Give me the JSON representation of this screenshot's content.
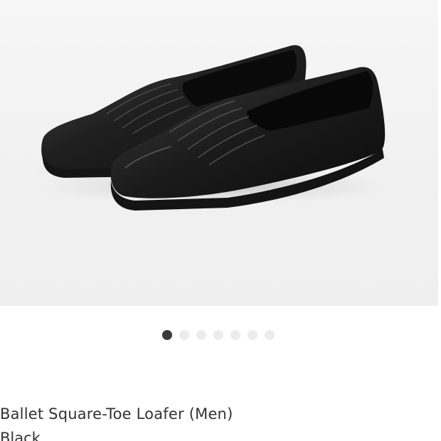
{
  "product": {
    "title": "Ballet Square-Toe Loafer (Men)",
    "color_partial": "Black"
  },
  "gallery": {
    "image_count": 7,
    "active_index": 0,
    "active_color": "#3b3b3b",
    "inactive_color": "#ececec",
    "image_icon": "shoe-photo"
  }
}
